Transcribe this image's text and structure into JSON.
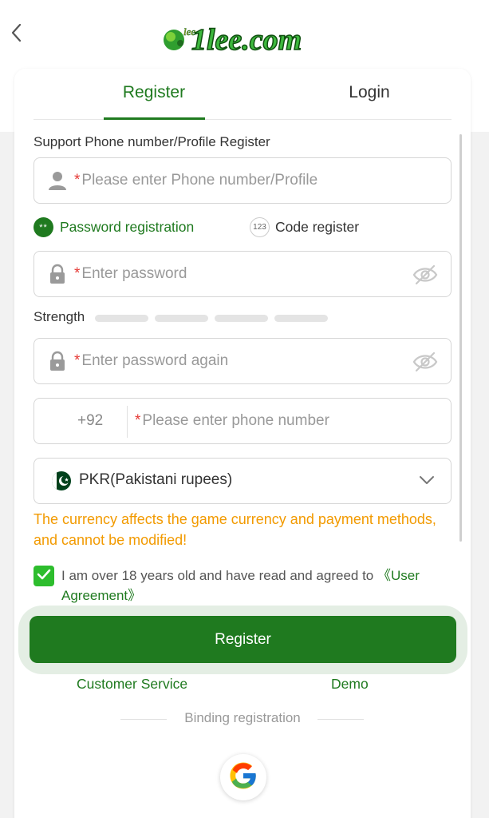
{
  "header": {
    "logo_text": "1lee.com",
    "logo_small": "lee"
  },
  "tabs": [
    {
      "label": "Register",
      "active": true
    },
    {
      "label": "Login",
      "active": false
    }
  ],
  "form": {
    "account_label": "Support Phone number/Profile Register",
    "account_placeholder": "Please enter Phone number/Profile",
    "required_mark": "*",
    "modes": {
      "password_badge": "**",
      "password_label": "Password registration",
      "code_badge": "123",
      "code_label": "Code register"
    },
    "password_placeholder": "Enter password",
    "strength_label": "Strength",
    "password_again_placeholder": "Enter password again",
    "country_code": "+92",
    "phone_placeholder": "Please enter phone number",
    "currency": "PKR(Pakistani rupees)",
    "currency_warning": "The currency affects the game currency and payment methods, and cannot be modified!",
    "agreement_text": "I am over 18 years old and have read and agreed to ",
    "agreement_link": "《User Agreement》",
    "agreement_checked": true,
    "register_button": "Register"
  },
  "footer": {
    "customer_service": "Customer Service",
    "demo": "Demo",
    "binding_registration": "Binding registration"
  },
  "colors": {
    "brand_green": "#1f7a1f",
    "checkbox_green": "#2dbd2d",
    "warning_orange": "#f29a00",
    "required_red": "#e53935"
  },
  "icons": [
    "back-arrow-icon",
    "user-icon",
    "lock-icon",
    "eye-off-icon",
    "pakistan-flag-icon",
    "chevron-down-icon",
    "checkmark-icon",
    "google-icon"
  ]
}
